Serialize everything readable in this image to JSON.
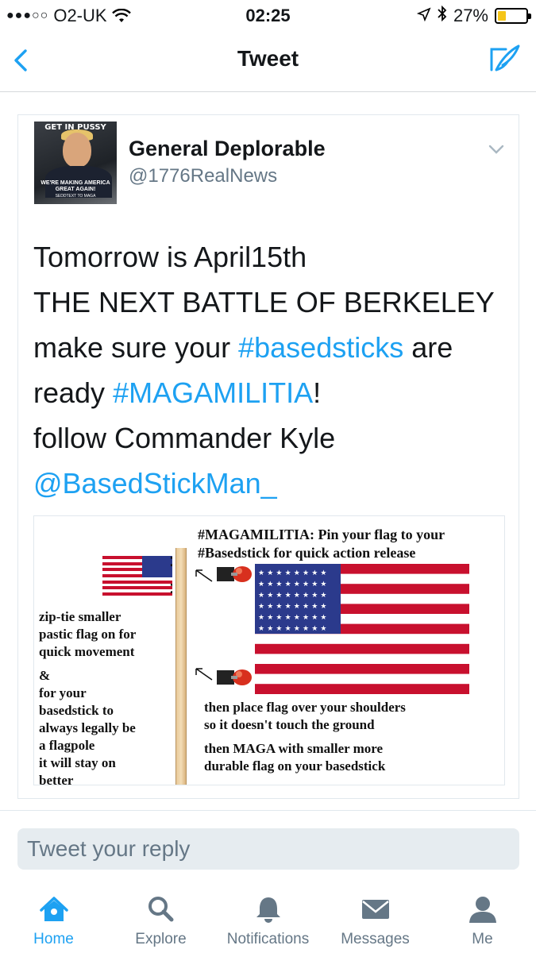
{
  "status_bar": {
    "carrier": "O2-UK",
    "signal_dots": "●●●○○",
    "time": "02:25",
    "battery_percent": "27%",
    "battery_level": 0.27
  },
  "nav": {
    "title": "Tweet"
  },
  "tweet": {
    "avatar": {
      "top_text": "GET IN PUSSY",
      "bottom_text": "WE'RE MAKING AMERICA GREAT AGAIN!",
      "tiny_text": "SEDDTEXT TO MAGA"
    },
    "display_name": "General Deplorable",
    "handle": "@1776RealNews",
    "text": {
      "line1": "Tomorrow is April15th",
      "line2": "THE NEXT BATTLE OF BERKELEY",
      "line3_a": "make sure your ",
      "line3_link": "#basedsticks",
      "line3_b": " are",
      "line4_a": "ready ",
      "line4_link": "#MAGAMILITIA",
      "line4_b": "!",
      "line5": "follow Commander Kyle",
      "line6_link": "@BasedStickMan_"
    },
    "image": {
      "title_line1": "#MAGAMILITIA: Pin your flag to your",
      "title_line2": "#Basedstick for quick action release",
      "left_lines": [
        "zip-tie smaller",
        "pastic flag on for",
        "quick movement",
        "&",
        "for your",
        "basedstick to",
        "always legally be",
        "a flagpole",
        "it will stay on",
        "better"
      ],
      "right_line1": "then place flag over your shoulders",
      "right_line2": "so it doesn't touch the ground",
      "right_line3": "then MAGA with smaller more",
      "right_line4": "durable flag on your basedstick"
    }
  },
  "reply": {
    "placeholder": "Tweet your reply"
  },
  "tabs": [
    {
      "label": "Home",
      "icon": "home-icon",
      "active": true
    },
    {
      "label": "Explore",
      "icon": "search-icon",
      "active": false
    },
    {
      "label": "Notifications",
      "icon": "bell-icon",
      "active": false
    },
    {
      "label": "Messages",
      "icon": "envelope-icon",
      "active": false
    },
    {
      "label": "Me",
      "icon": "person-icon",
      "active": false
    }
  ],
  "colors": {
    "accent": "#1da1f2",
    "secondary_text": "#657786",
    "battery_fill": "#f5c518"
  }
}
